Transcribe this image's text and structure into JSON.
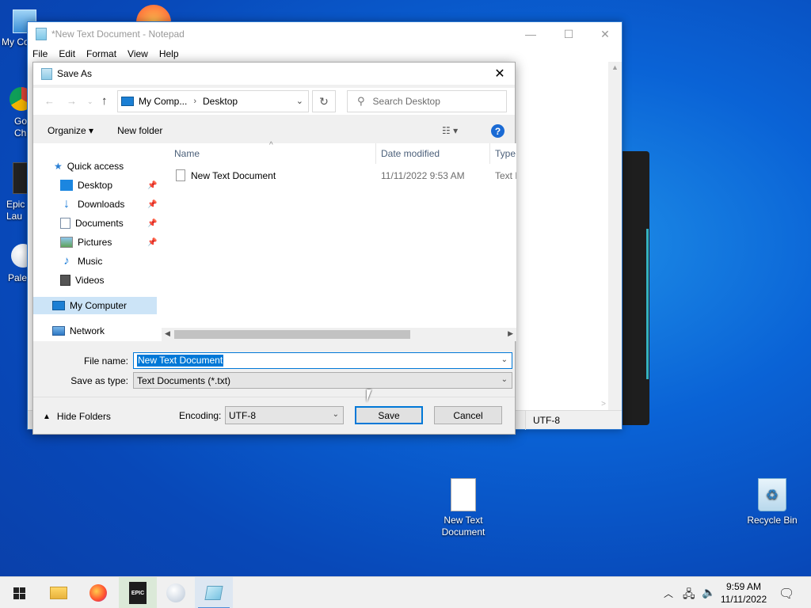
{
  "desktop": {
    "icons": [
      {
        "label": "My Co"
      },
      {
        "label": "Go Chr"
      },
      {
        "label": "Epic Lau"
      },
      {
        "label": "Pale"
      },
      {
        "label": "New Text Document"
      },
      {
        "label": "Recycle Bin"
      }
    ],
    "epic_badge": "EPIC\nGAMES"
  },
  "notepad": {
    "title": "*New Text Document - Notepad",
    "menu": [
      "File",
      "Edit",
      "Format",
      "View",
      "Help"
    ],
    "status_encoding": "UTF-8"
  },
  "dialog": {
    "title": "Save As",
    "address": {
      "root": "My Comp...",
      "folder": "Desktop"
    },
    "search_placeholder": "Search Desktop",
    "toolbar": {
      "organize": "Organize ▾",
      "new_folder": "New folder"
    },
    "nav": {
      "quick_access": "Quick access",
      "items": [
        "Desktop",
        "Downloads",
        "Documents",
        "Pictures",
        "Music",
        "Videos"
      ],
      "my_computer": "My Computer",
      "network": "Network"
    },
    "columns": [
      "Name",
      "Date modified",
      "Type"
    ],
    "files": [
      {
        "name": "New Text Document",
        "modified": "11/11/2022 9:53 AM",
        "type": "Text D"
      }
    ],
    "file_name_label": "File name:",
    "file_name_value": "New Text Document",
    "save_type_label": "Save as type:",
    "save_type_value": "Text Documents (*.txt)",
    "hide_folders": "Hide Folders",
    "encoding_label": "Encoding:",
    "encoding_value": "UTF-8",
    "save_label": "Save",
    "cancel_label": "Cancel"
  },
  "taskbar": {
    "time": "9:59 AM",
    "date": "11/11/2022",
    "epic_label": "EPIC"
  },
  "colors": {
    "accent": "#0078d7",
    "desktop": "#0a63d6",
    "selection": "#cce4f7"
  }
}
